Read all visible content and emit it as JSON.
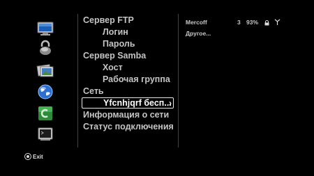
{
  "sidebar": {
    "icons": [
      "monitor-icon",
      "lock-icon",
      "photo-icon",
      "globe-network-icon",
      "green-app-icon",
      "terminal-icon"
    ]
  },
  "menu": {
    "items": [
      {
        "label": "Сервер FTP"
      },
      {
        "label": "Логин"
      },
      {
        "label": "Пароль"
      },
      {
        "label": "Сервер Samba"
      },
      {
        "label": "Хост"
      },
      {
        "label": "Рабочая группа"
      },
      {
        "label": "Сеть"
      },
      {
        "label": "Yfcnhjqrf бесп..."
      },
      {
        "label": "Информация о сети"
      },
      {
        "label": "Статус подключения"
      }
    ],
    "selected_chevron": "›"
  },
  "networks": {
    "rows": [
      {
        "ssid": "Mercoff",
        "channel": "3",
        "signal": "93%",
        "locked": true,
        "wifi_icon": "wifi-signal-icon"
      },
      {
        "ssid": "Другое...",
        "channel": "",
        "signal": "",
        "locked": false
      }
    ]
  },
  "footer": {
    "exit_label": "Exit"
  },
  "colors": {
    "divider": "#b21313",
    "background": "#000000",
    "text": "#c8c8c8",
    "selected_border": "#e6e6e6"
  }
}
